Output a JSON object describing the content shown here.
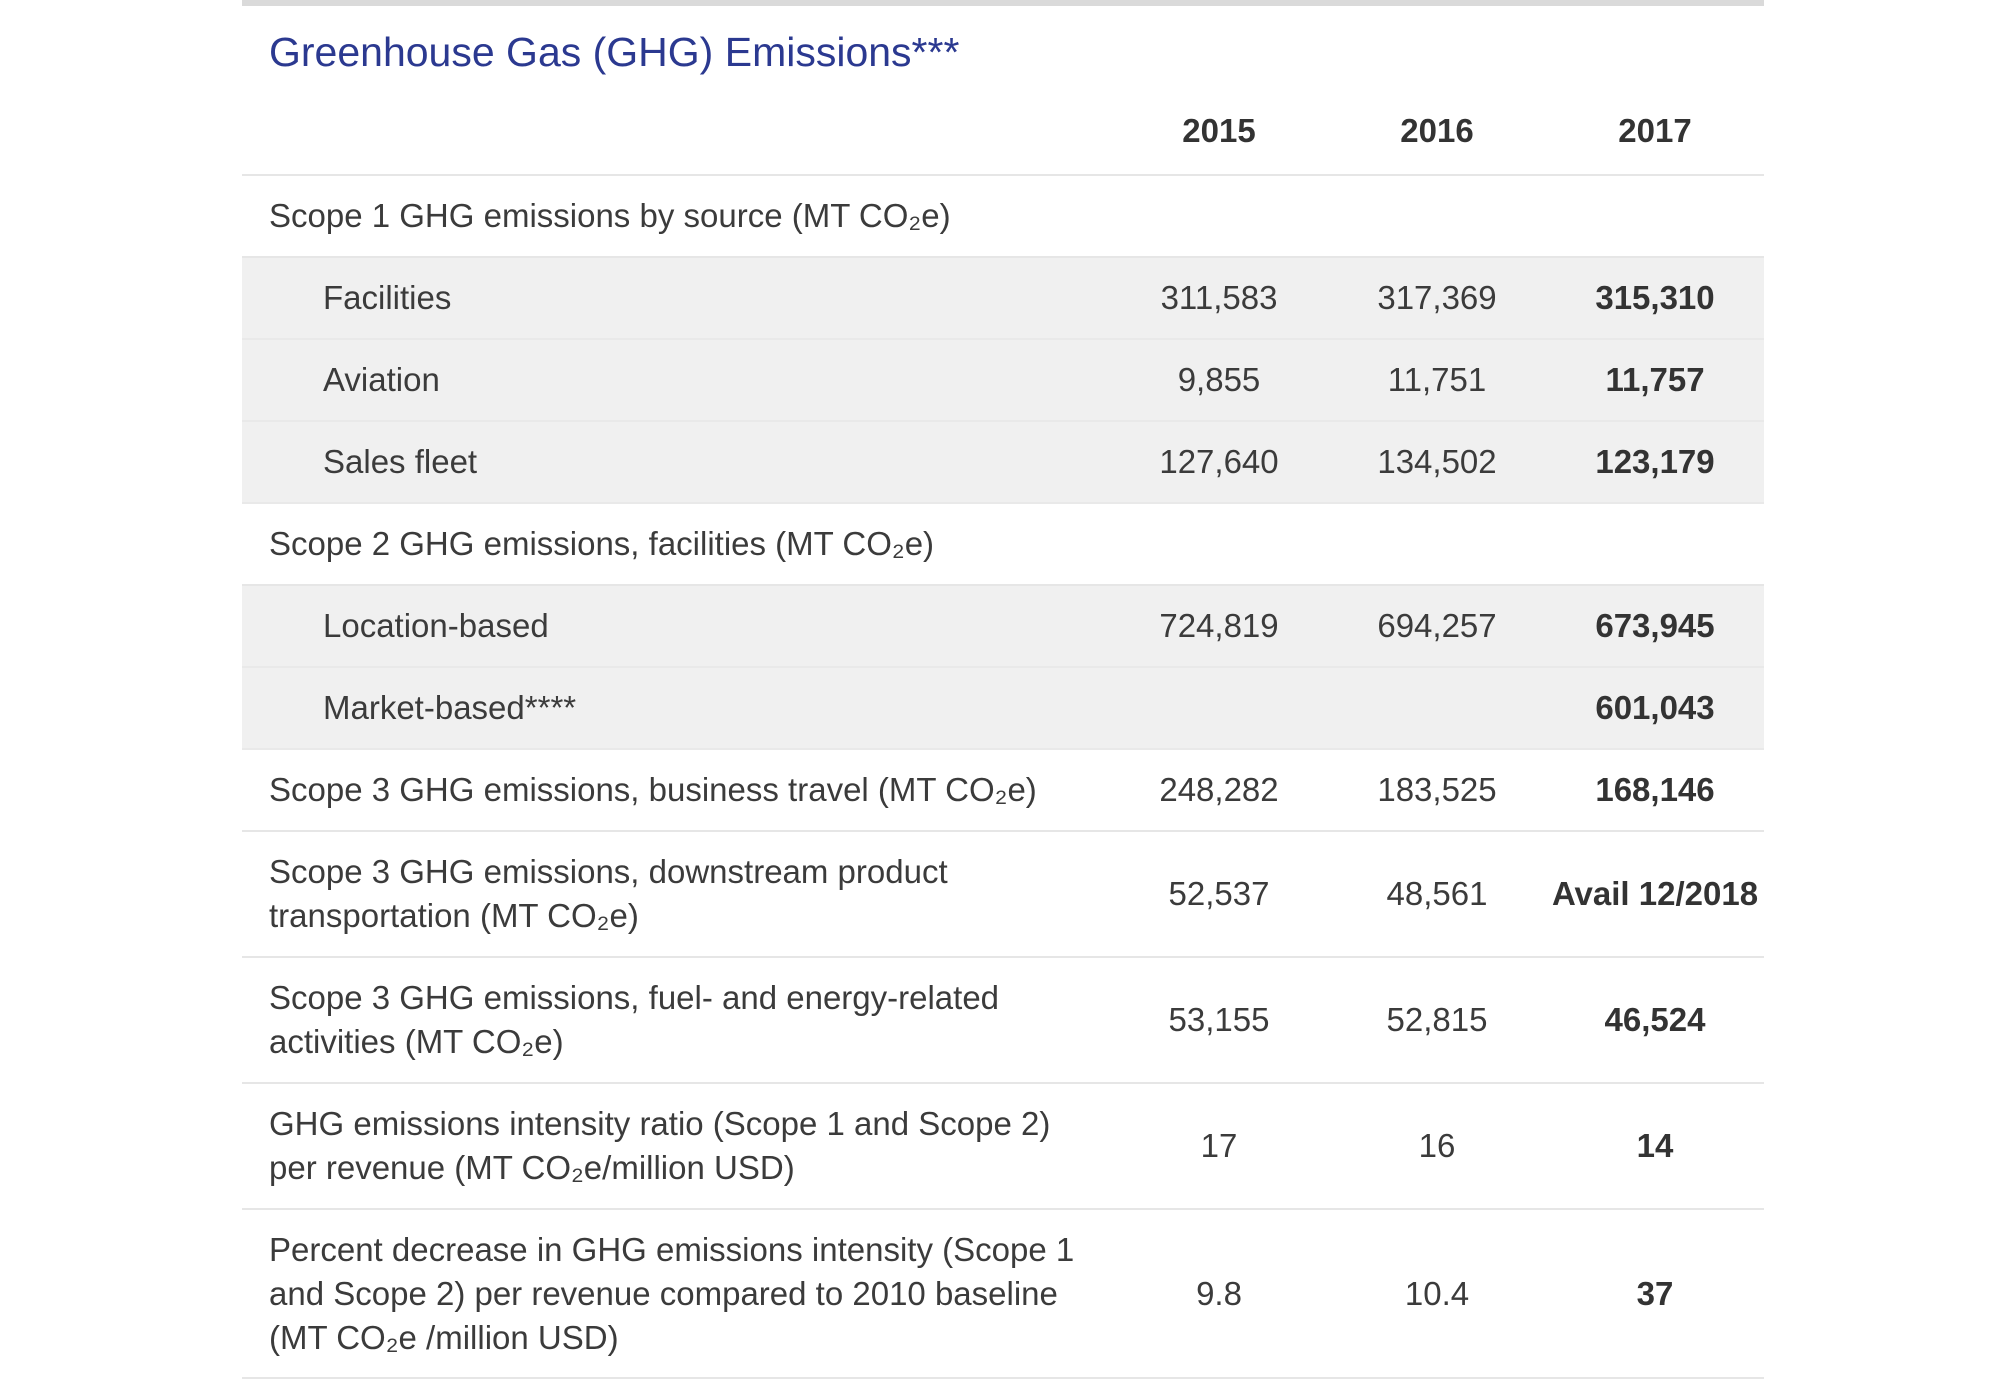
{
  "title": "Greenhouse Gas (GHG) Emissions***",
  "columns": [
    "2015",
    "2016",
    "2017"
  ],
  "rows": [
    {
      "label": "Scope 1 GHG emissions by source (MT CO₂e)",
      "values": [
        "",
        "",
        ""
      ]
    },
    {
      "label": "Facilities",
      "values": [
        "311,583",
        "317,369",
        "315,310"
      ]
    },
    {
      "label": "Aviation",
      "values": [
        "9,855",
        "11,751",
        "11,757"
      ]
    },
    {
      "label": "Sales fleet",
      "values": [
        "127,640",
        "134,502",
        "123,179"
      ]
    },
    {
      "label": "Scope 2 GHG emissions, facilities (MT CO₂e)",
      "values": [
        "",
        "",
        ""
      ]
    },
    {
      "label": "Location-based",
      "values": [
        "724,819",
        "694,257",
        "673,945"
      ]
    },
    {
      "label": "Market-based****",
      "values": [
        "",
        "",
        "601,043"
      ]
    },
    {
      "label": "Scope 3 GHG emissions, business travel (MT CO₂e)",
      "values": [
        "248,282",
        "183,525",
        "168,146"
      ]
    },
    {
      "label": "Scope 3 GHG emissions, downstream product transportation (MT CO₂e)",
      "values": [
        "52,537",
        "48,561",
        "Avail 12/2018"
      ]
    },
    {
      "label": "Scope 3 GHG emissions, fuel- and energy-related activities (MT CO₂e)",
      "values": [
        "53,155",
        "52,815",
        "46,524"
      ]
    },
    {
      "label": "GHG emissions intensity ratio (Scope 1 and Scope 2) per revenue (MT CO₂e/million USD)",
      "values": [
        "17",
        "16",
        "14"
      ]
    },
    {
      "label": "Percent decrease in GHG emissions intensity (Scope 1 and Scope 2) per revenue compared to 2010 baseline (MT CO₂e /million USD)",
      "values": [
        "9.8",
        "10.4",
        "37"
      ]
    }
  ]
}
